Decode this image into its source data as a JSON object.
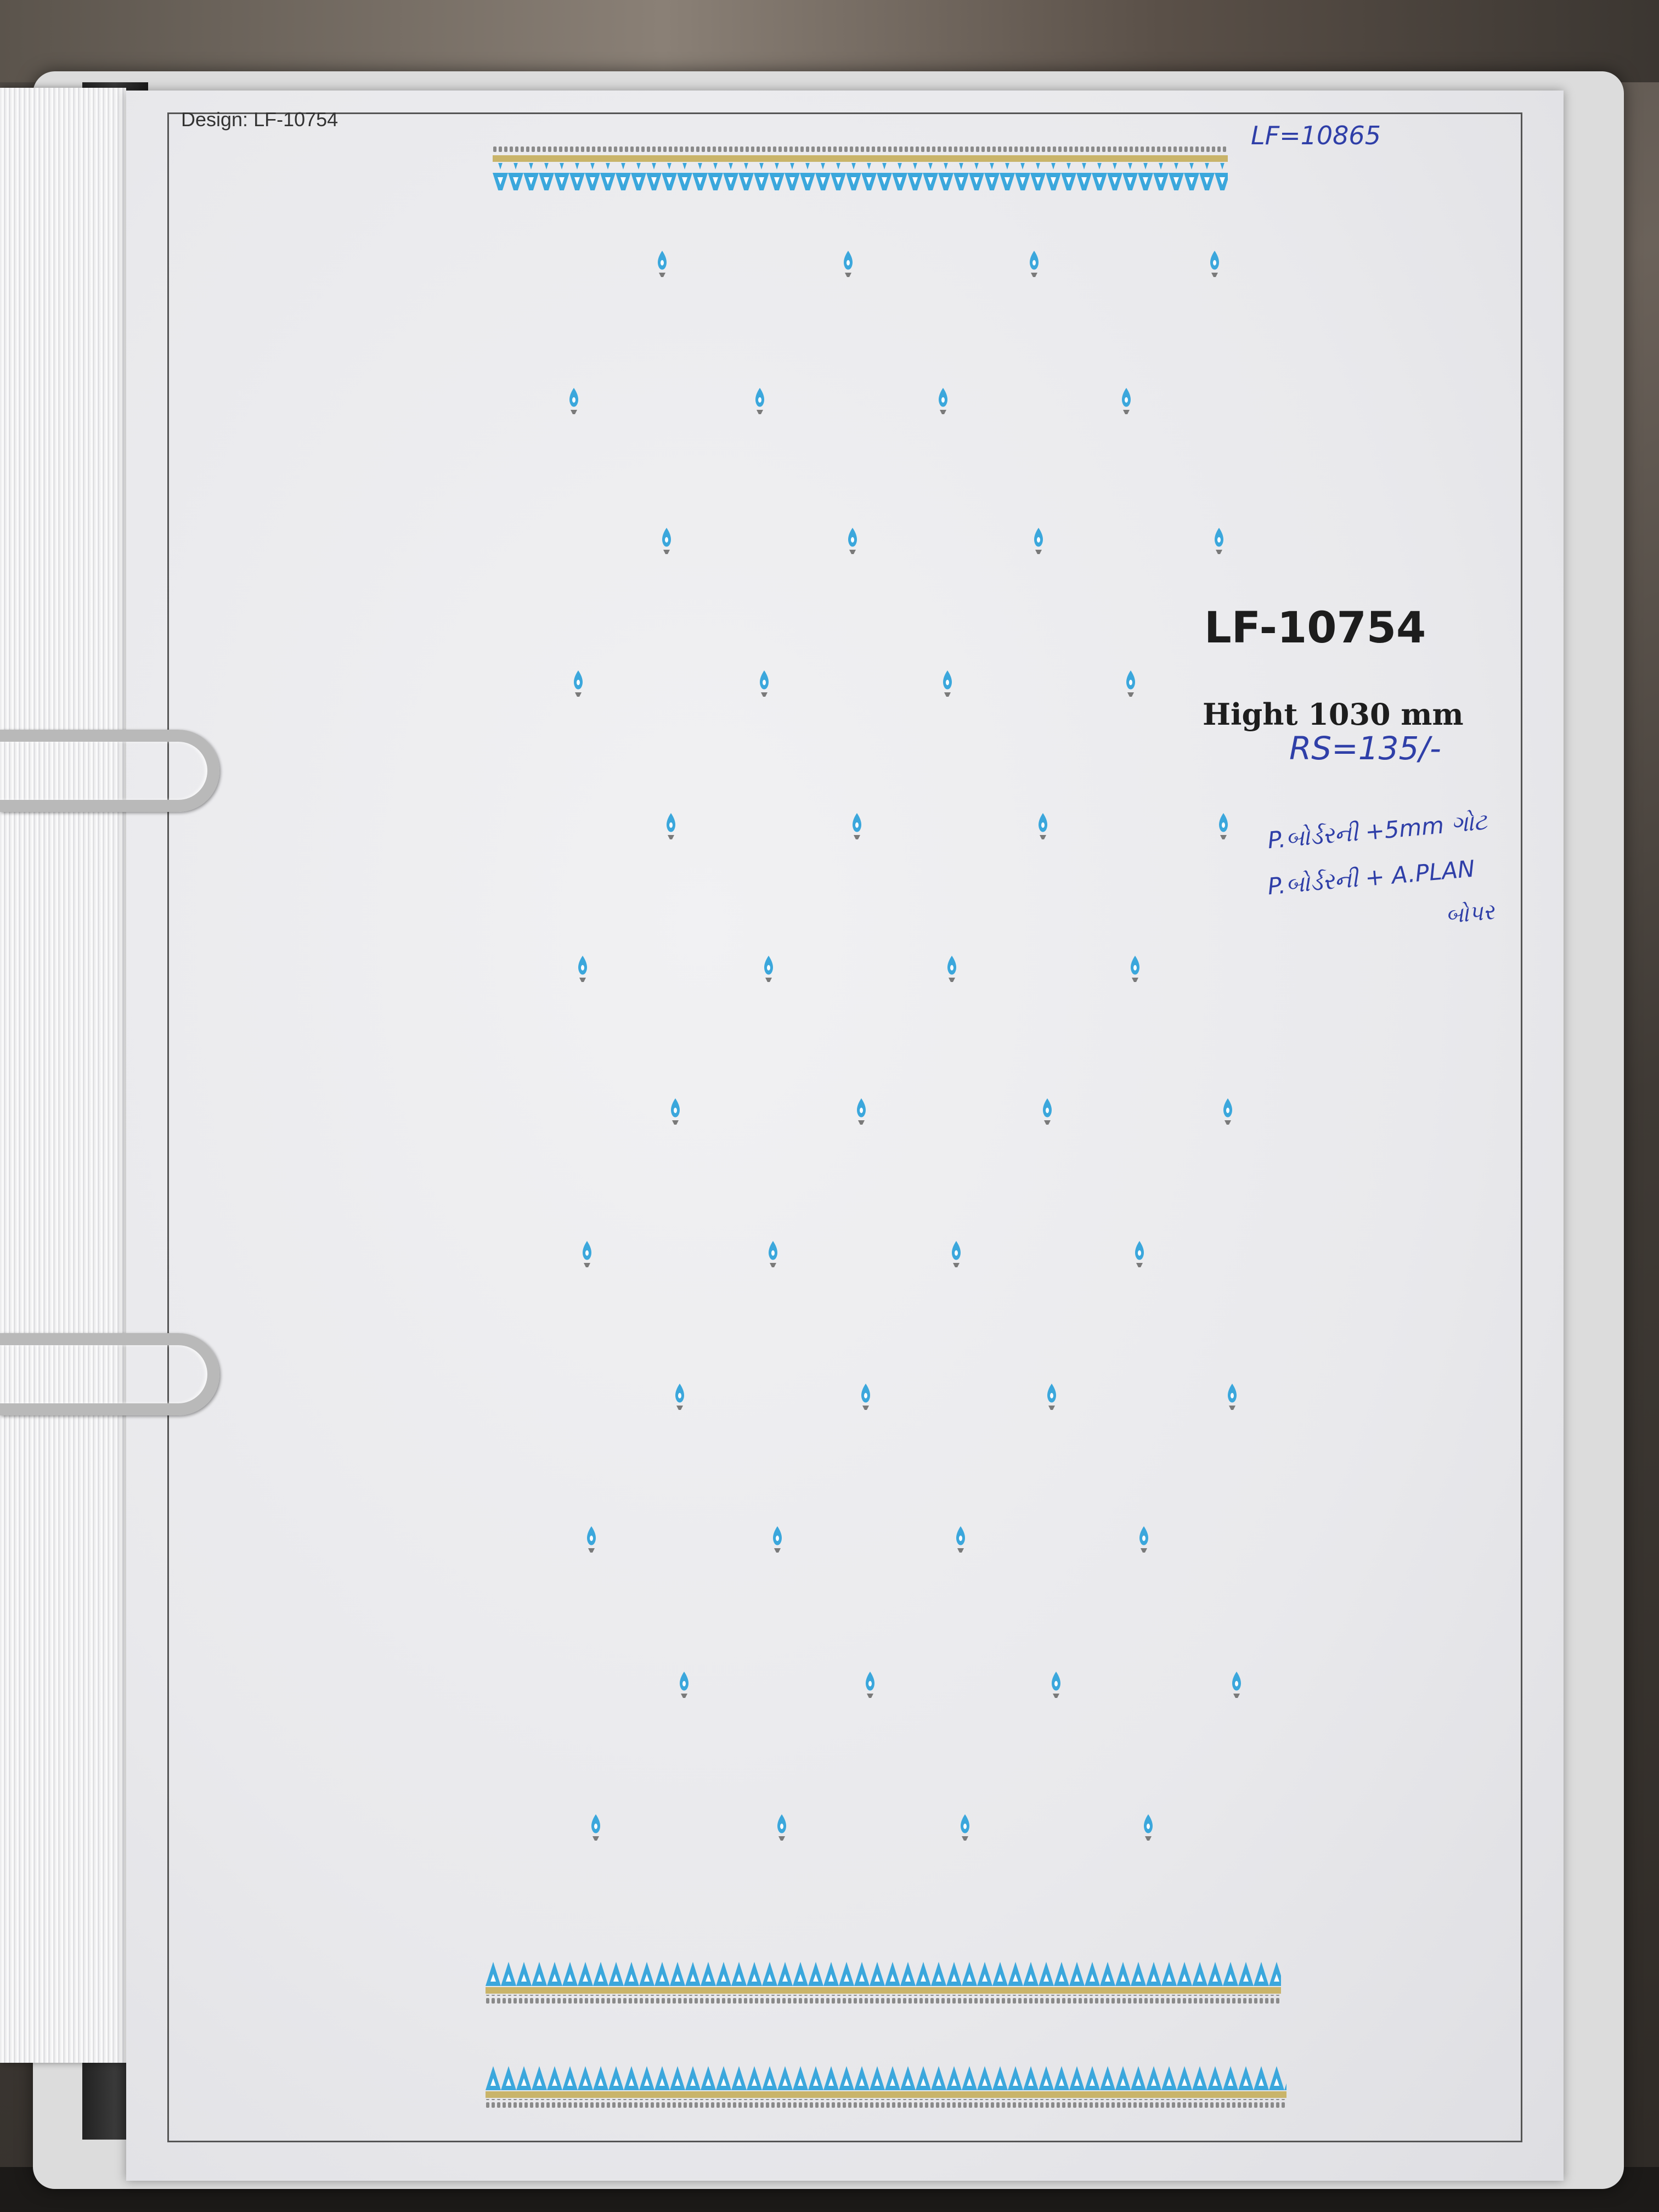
{
  "sheet": {
    "design_label": "Design:  LF-10754",
    "title": "LF-10754",
    "height_note": "Hight 1030 mm"
  },
  "handwritten": {
    "top_ref": "LF=10865",
    "rate": "RS=135/-",
    "line1": "P.બોર્ડરની +5mm ગોટ",
    "line2": "P.બોર્ડરની + A.PLAN",
    "line3": "બોપર"
  },
  "colors": {
    "motif_blue": "#3ba7dc",
    "border_gold": "#c9b46a",
    "border_grey": "#8a8a8a",
    "handwriting": "#2f3fa8"
  },
  "icons": [
    "butta-motif-icon",
    "border-pattern-icon",
    "binder-ring-icon"
  ]
}
